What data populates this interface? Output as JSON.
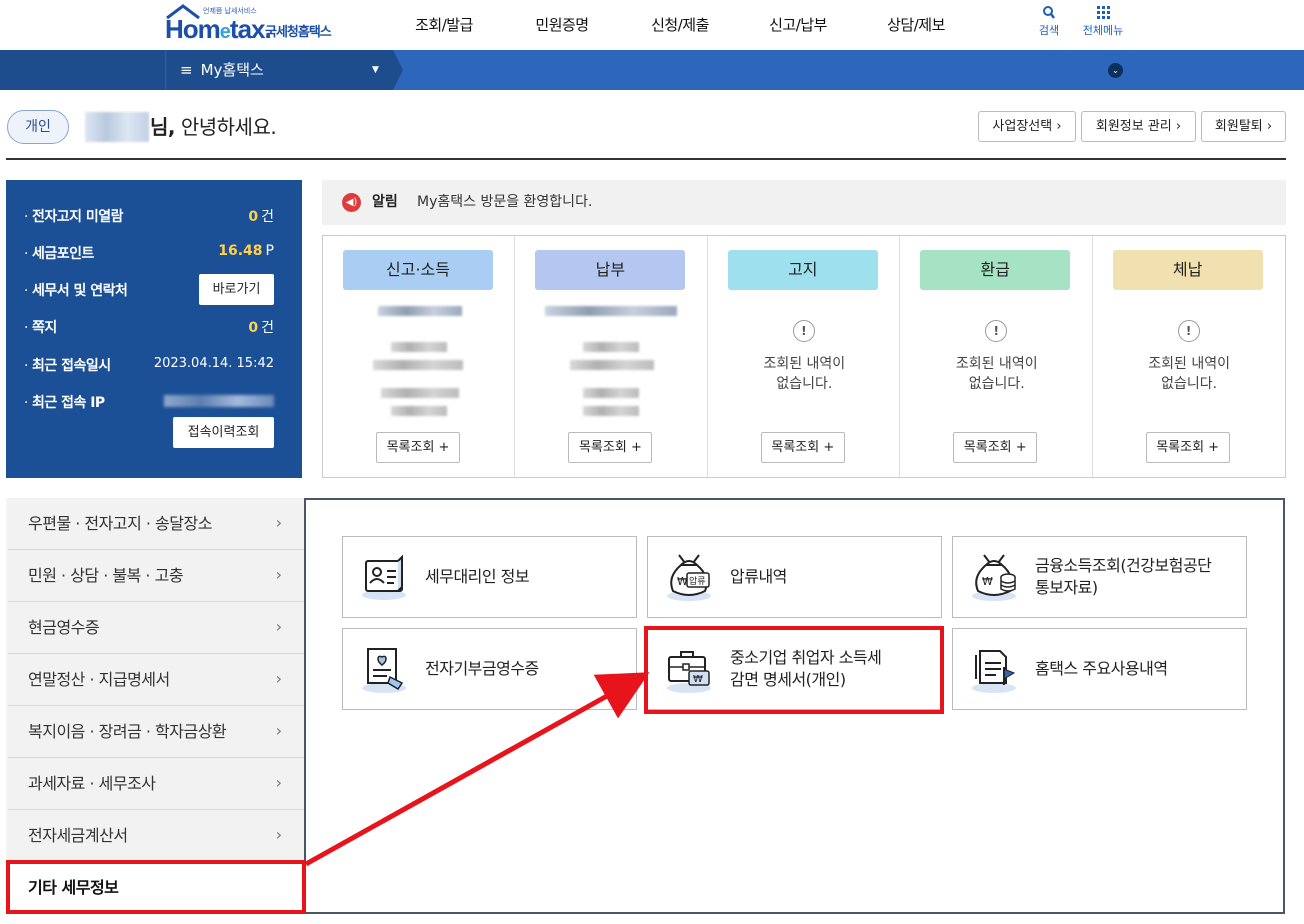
{
  "header": {
    "logo_tag": "언제쯤 납세서비스",
    "logo_main_pre": "Hom",
    "logo_main_e": "e",
    "logo_main_post": "tax.",
    "logo_sub": "국세청홈택스",
    "gnb": [
      "조회/발급",
      "민원증명",
      "신청/제출",
      "신고/납부",
      "상담/제보"
    ],
    "search_label": "검색",
    "allmenu_label": "전체메뉴"
  },
  "navbar": {
    "title": "My홈택스",
    "menu_glyph": "≡",
    "caret": "▼",
    "circle": "⌄"
  },
  "greeting": {
    "badge": "개인",
    "suffix_bold": "님,",
    "suffix": " 안녕하세요.",
    "buttons": [
      "사업장선택 ›",
      "회원정보 관리 ›",
      "회원탈퇴 ›"
    ]
  },
  "info": {
    "rows": [
      {
        "label": "전자고지 미열람",
        "value": "0",
        "unit": "건"
      },
      {
        "label": "세금포인트",
        "value": "16.48",
        "unit": "P"
      },
      {
        "label": "세무서 및 연락처",
        "button": "바로가기"
      },
      {
        "label": "쪽지",
        "value": "0",
        "unit": "건"
      },
      {
        "label": "최근 접속일시",
        "date": "2023.04.14.  15:42"
      },
      {
        "label": "최근 접속 IP"
      }
    ],
    "history_button": "접속이력조회",
    "dot": "·"
  },
  "notice": {
    "icon": "◀)",
    "label": "알림",
    "text": "My홈택스 방문을 환영합니다."
  },
  "cards": [
    {
      "title": "신고·소득",
      "color": "#a9cdf3",
      "empty": false,
      "button": "목록조회 +"
    },
    {
      "title": "납부",
      "color": "#b4c7f1",
      "empty": false,
      "button": "목록조회 +"
    },
    {
      "title": "고지",
      "color": "#9fe0ef",
      "empty": true,
      "empty_line1": "조회된 내역이",
      "empty_line2": "없습니다.",
      "button": "목록조회 +"
    },
    {
      "title": "환급",
      "color": "#a6e3c4",
      "empty": true,
      "empty_line1": "조회된 내역이",
      "empty_line2": "없습니다.",
      "button": "목록조회 +"
    },
    {
      "title": "체납",
      "color": "#f1e0b0",
      "empty": true,
      "empty_line1": "조회된 내역이",
      "empty_line2": "없습니다.",
      "button": "목록조회 +"
    }
  ],
  "left_menu": [
    "우편물 · 전자고지 · 송달장소",
    "민원 · 상담 · 불복 · 고충",
    "현금영수증",
    "연말정산 · 지급명세서",
    "복지이음 · 장려금 · 학자금상환",
    "과세자료 · 세무조사",
    "전자세금계산서",
    "기타 세무정보"
  ],
  "left_menu_chevron": "›",
  "tiles": [
    {
      "line1": "세무대리인 정보",
      "line2": "",
      "icon": "tax-agent-card-icon"
    },
    {
      "line1": "압류내역",
      "line2": "",
      "icon": "seizure-moneybag-icon",
      "stamp": "압류"
    },
    {
      "line1": "금융소득조회(건강보험공단",
      "line2": "통보자료)",
      "icon": "financial-income-moneybag-icon"
    },
    {
      "line1": "전자기부금영수증",
      "line2": "",
      "icon": "donation-receipt-icon"
    },
    {
      "line1": "중소기업 취업자 소득세",
      "line2": "감면 명세서(개인)",
      "icon": "briefcase-won-icon"
    },
    {
      "line1": "홈택스 주요사용내역",
      "line2": "",
      "icon": "usage-history-doc-icon"
    }
  ],
  "won_symbol": "₩",
  "exclaim": "!",
  "colors": {
    "navy": "#1b4f96",
    "nav_blue": "#2d67bb",
    "highlight_red": "#e8141c",
    "point_yellow": "#ffd24a"
  }
}
